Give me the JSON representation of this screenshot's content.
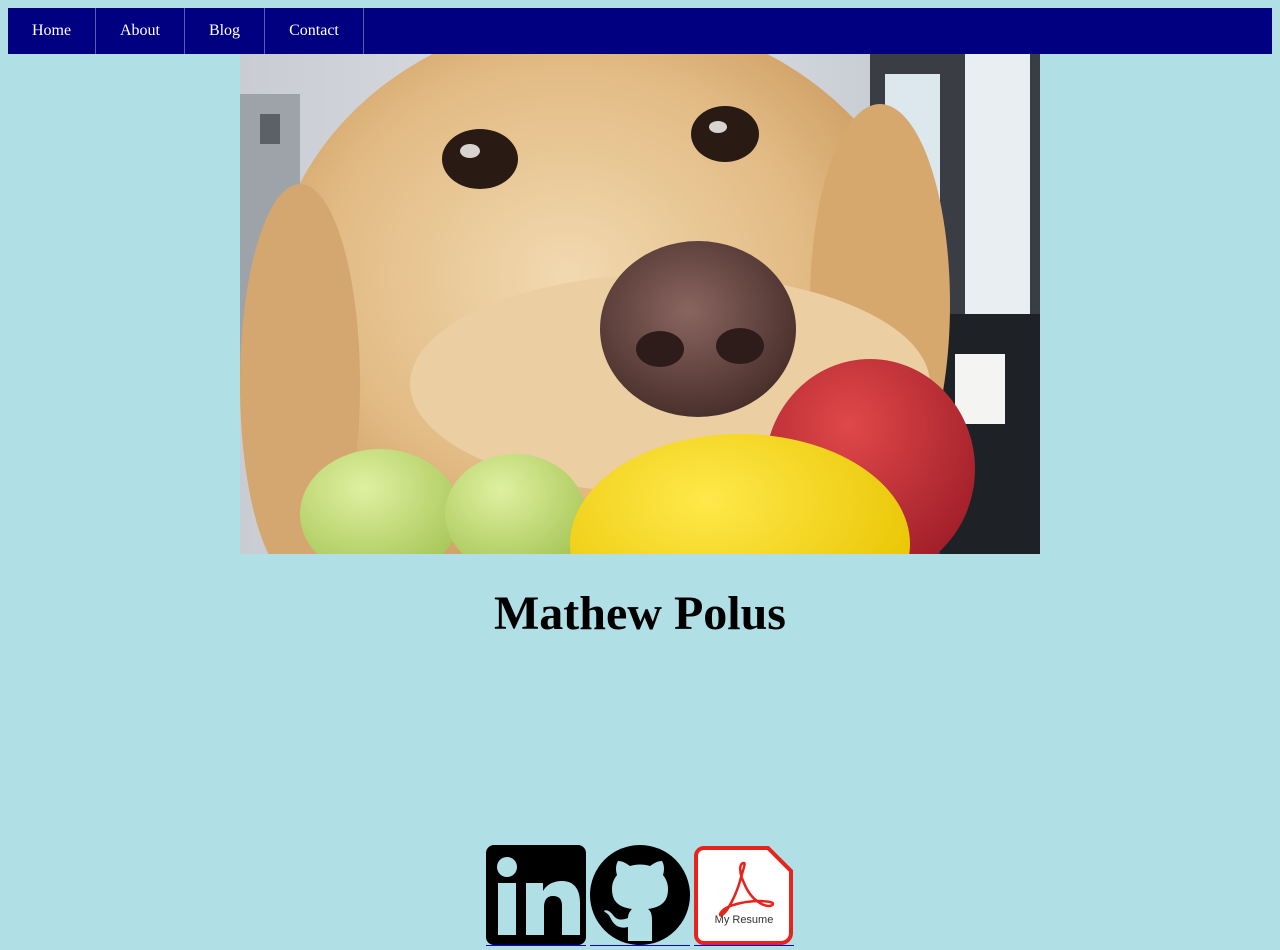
{
  "nav": {
    "bg_color": "#000080",
    "items": [
      {
        "label": "Home"
      },
      {
        "label": "About"
      },
      {
        "label": "Blog"
      },
      {
        "label": "Contact"
      }
    ]
  },
  "hero": {
    "image_alt": "golden retriever with tennis balls in its mouth"
  },
  "title": "Mathew Polus",
  "socials": {
    "links": [
      {
        "icon": "linkedin-icon"
      },
      {
        "icon": "github-icon"
      },
      {
        "icon": "pdf-resume-icon",
        "caption": "My Resume",
        "color": "#e8231b"
      }
    ]
  },
  "page_bg": "#b0dfe5"
}
